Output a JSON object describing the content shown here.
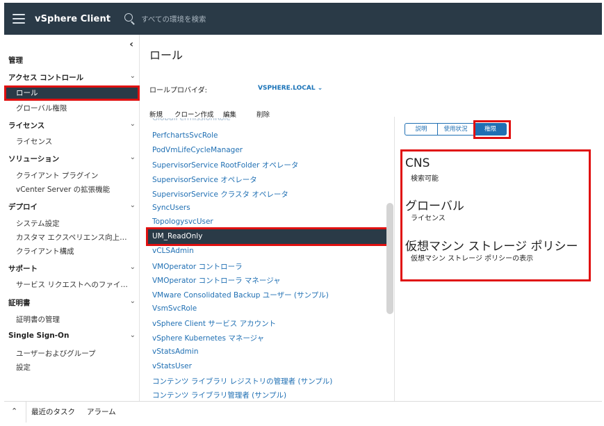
{
  "header": {
    "app_title": "vSphere Client",
    "search_placeholder": "すべての環境を検索"
  },
  "sidebar": {
    "section_title": "管理",
    "groups": [
      {
        "label": "アクセス コントロール",
        "items": [
          "ロール",
          "グローバル権限"
        ]
      },
      {
        "label": "ライセンス",
        "items": [
          "ライセンス"
        ]
      },
      {
        "label": "ソリューション",
        "items": [
          "クライアント プラグイン",
          "vCenter Server の拡張機能"
        ]
      },
      {
        "label": "デプロイ",
        "items": [
          "システム設定",
          "カスタマ エクスペリエンス向上プロ...",
          "クライアント構成"
        ]
      },
      {
        "label": "サポート",
        "items": [
          "サービス リクエストへのファイルの..."
        ]
      },
      {
        "label": "証明書",
        "items": [
          "証明書の管理"
        ]
      },
      {
        "label": "Single Sign-On",
        "items": [
          "ユーザーおよびグループ",
          "設定"
        ]
      }
    ]
  },
  "main": {
    "title": "ロール",
    "provider_label": "ロールプロバイダ:",
    "provider_value": "VSPHERE.LOCAL",
    "actions": [
      "新規",
      "クローン作成",
      "編集",
      "削除"
    ],
    "roles": [
      "PerfchartsSvcRole",
      "PodVmLifeCycleManager",
      "SupervisorService RootFolder オペレータ",
      "SupervisorService オペレータ",
      "SupervisorService クラスタ オペレータ",
      "SyncUsers",
      "TopologysvcUser",
      "UM_ReadOnly",
      "vCLSAdmin",
      "VMOperator コントローラ",
      "VMOperator コントローラ マネージャ",
      "VMware Consolidated Backup ユーザー (サンプル)",
      "VsmSvcRole",
      "vSphere Client サービス アカウント",
      "vSphere Kubernetes マネージャ",
      "vStatsAdmin",
      "vStatsUser",
      "コンテンツ ライブラリ レジストリの管理者 (サンプル)",
      "コンテンツ ライブラリ管理者 (サンプル)"
    ],
    "selected_role": "UM_ReadOnly"
  },
  "details": {
    "tabs": [
      "説明",
      "使用状況",
      "権限"
    ],
    "active_tab": "権限",
    "privileges": [
      {
        "title": "CNS",
        "sub": "検索可能"
      },
      {
        "title": "グローバル",
        "sub": "ライセンス"
      },
      {
        "title": "仮想マシン ストレージ ポリシー",
        "sub": "仮想マシン ストレージ ポリシーの表示"
      }
    ]
  },
  "bottom": {
    "tabs": [
      "最近のタスク",
      "アラーム"
    ]
  },
  "colors": {
    "header_bg": "#2a3a47",
    "link": "#1f6fb3",
    "highlight": "#e01010"
  }
}
